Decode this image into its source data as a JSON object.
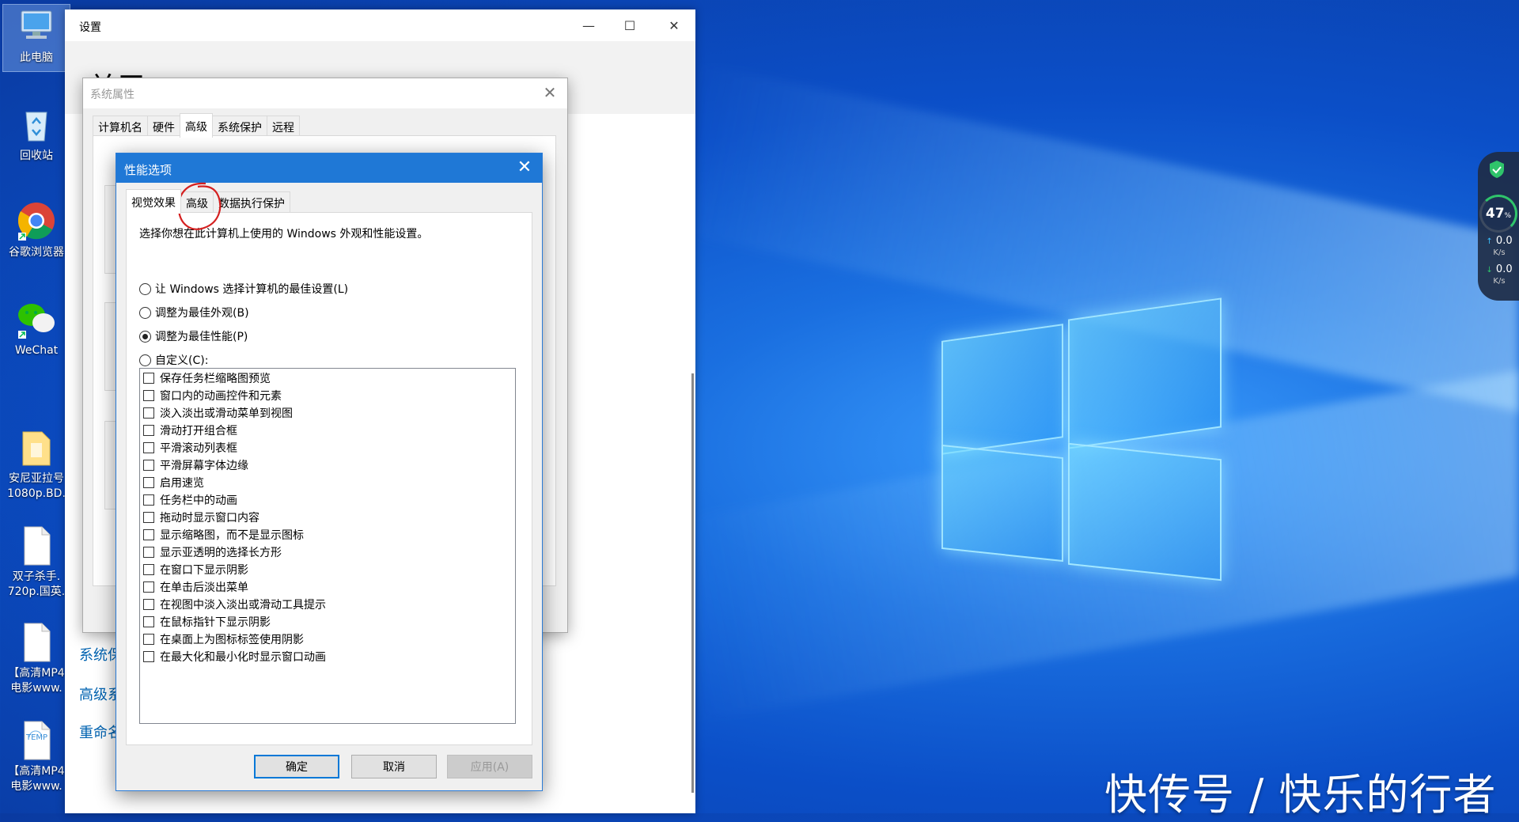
{
  "desktop": {
    "icons": [
      {
        "label": "此电脑"
      },
      {
        "label": "回收站"
      },
      {
        "label": "谷歌浏览器"
      },
      {
        "label": "WeChat"
      },
      {
        "label": "安尼亚拉号\n1080p.BD."
      },
      {
        "label": "双子杀手.\n720p.国英."
      },
      {
        "label": "【高清MP4\n电影www."
      },
      {
        "label": "【高清MP4\n电影www."
      }
    ],
    "temp_icon_text": "TEMP"
  },
  "settings_window": {
    "title": "设置",
    "heading": "关于",
    "links": [
      "系统保",
      "高级系",
      "重命名"
    ],
    "controls": {
      "minimize": "—",
      "maximize": "☐",
      "close": "✕"
    }
  },
  "system_properties": {
    "title": "系统属性",
    "tabs": [
      "计算机名",
      "硬件",
      "高级",
      "系统保护",
      "远程"
    ],
    "active_tab": "高级"
  },
  "performance_options": {
    "title": "性能选项",
    "tabs": [
      "视觉效果",
      "高级",
      "数据执行保护"
    ],
    "active_tab": "视觉效果",
    "description": "选择你想在此计算机上使用的 Windows 外观和性能设置。",
    "radios": [
      {
        "label": "让 Windows 选择计算机的最佳设置(L)",
        "checked": false
      },
      {
        "label": "调整为最佳外观(B)",
        "checked": false
      },
      {
        "label": "调整为最佳性能(P)",
        "checked": true
      },
      {
        "label": "自定义(C):",
        "checked": false
      }
    ],
    "checkboxes": [
      {
        "label": "保存任务栏缩略图预览",
        "checked": false
      },
      {
        "label": "窗口内的动画控件和元素",
        "checked": false
      },
      {
        "label": "淡入淡出或滑动菜单到视图",
        "checked": false
      },
      {
        "label": "滑动打开组合框",
        "checked": false
      },
      {
        "label": "平滑滚动列表框",
        "checked": false
      },
      {
        "label": "平滑屏幕字体边缘",
        "checked": false
      },
      {
        "label": "启用速览",
        "checked": false
      },
      {
        "label": "任务栏中的动画",
        "checked": false
      },
      {
        "label": "拖动时显示窗口内容",
        "checked": false
      },
      {
        "label": "显示缩略图，而不是显示图标",
        "checked": false
      },
      {
        "label": "显示亚透明的选择长方形",
        "checked": false
      },
      {
        "label": "在窗口下显示阴影",
        "checked": false
      },
      {
        "label": "在单击后淡出菜单",
        "checked": false
      },
      {
        "label": "在视图中淡入淡出或滑动工具提示",
        "checked": false
      },
      {
        "label": "在鼠标指针下显示阴影",
        "checked": false
      },
      {
        "label": "在桌面上为图标标签使用阴影",
        "checked": false
      },
      {
        "label": "在最大化和最小化时显示窗口动画",
        "checked": false
      }
    ],
    "buttons": {
      "ok": "确定",
      "cancel": "取消",
      "apply": "应用(A)"
    }
  },
  "side_widget": {
    "percent": "47",
    "percent_unit": "%",
    "upload": "0.0",
    "download": "0.0",
    "unit": "K/s"
  },
  "watermark": "快传号 / 快乐的行者",
  "colors": {
    "accent": "#1f78d6",
    "link": "#0063b1",
    "annotation": "#d42020",
    "widget_green": "#2fc46b"
  }
}
